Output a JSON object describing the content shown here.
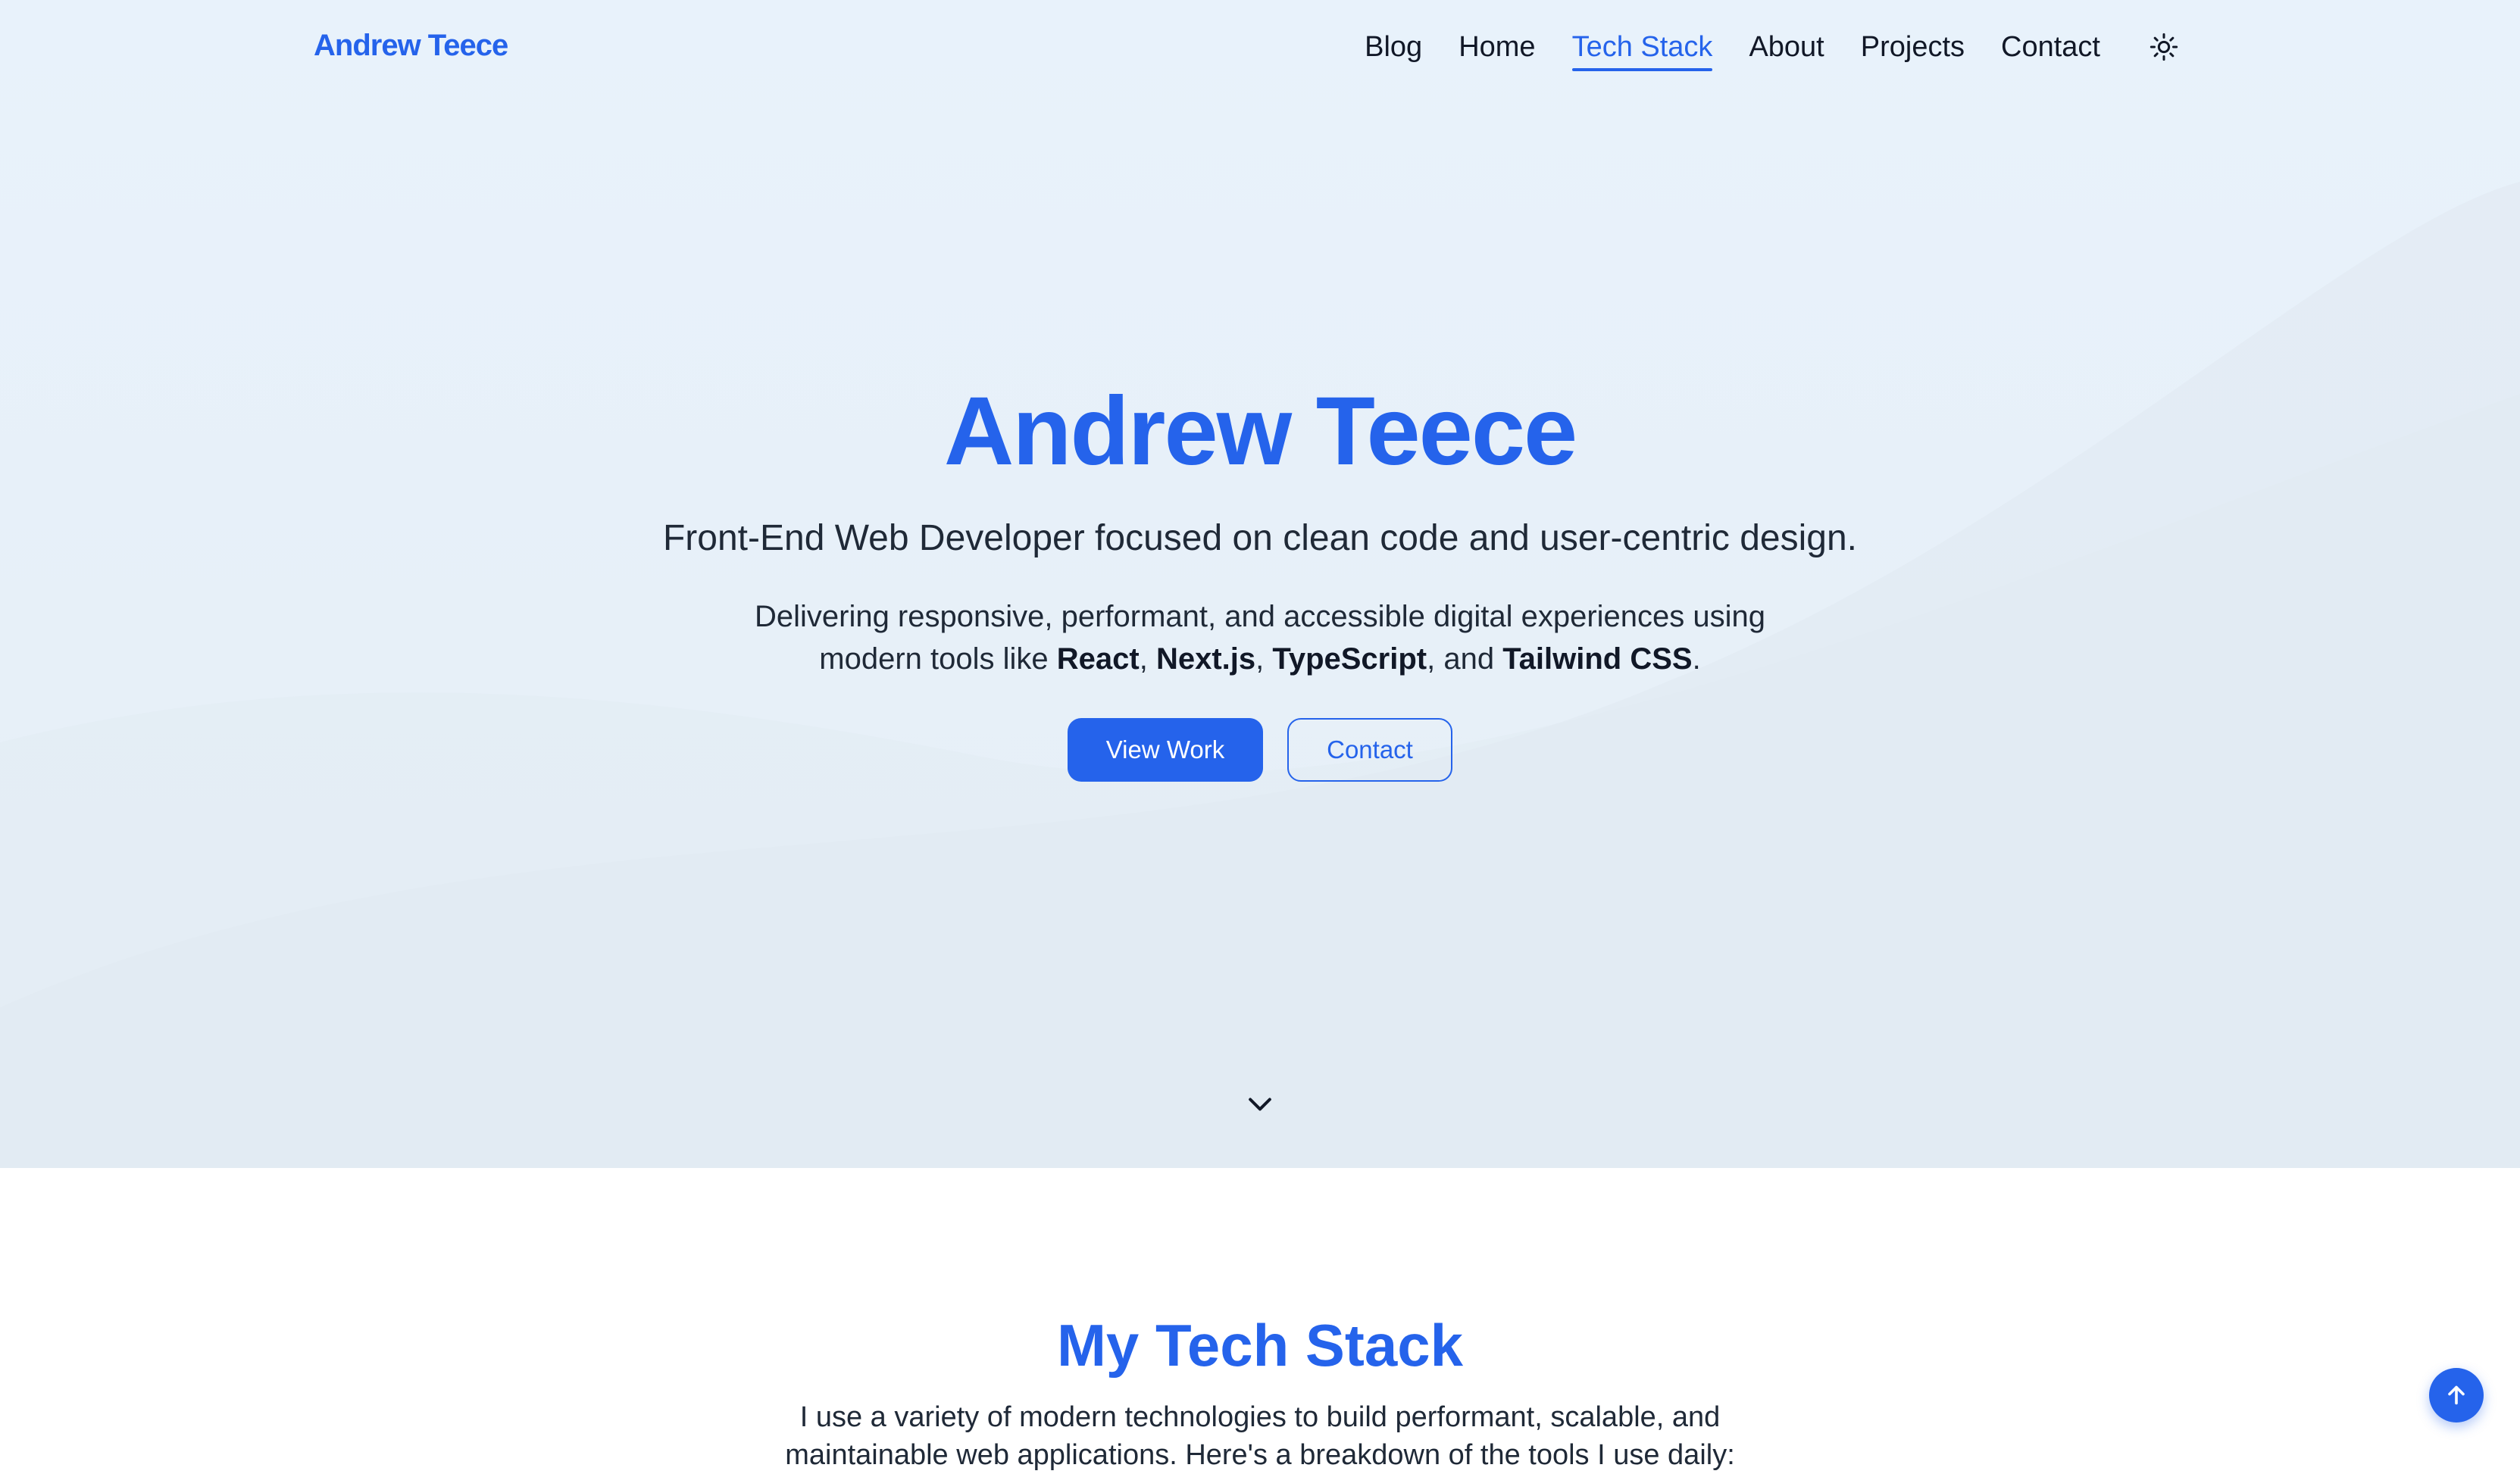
{
  "header": {
    "logo": "Andrew Teece",
    "nav": [
      {
        "label": "Blog",
        "active": false
      },
      {
        "label": "Home",
        "active": false
      },
      {
        "label": "Tech Stack",
        "active": true
      },
      {
        "label": "About",
        "active": false
      },
      {
        "label": "Projects",
        "active": false
      },
      {
        "label": "Contact",
        "active": false
      }
    ],
    "theme_icon": "sun-icon"
  },
  "hero": {
    "title": "Andrew Teece",
    "subtitle": "Front-End Web Developer focused on clean code and user-centric design.",
    "desc_part1": "Delivering responsive, performant, and accessible digital experiences using modern tools like ",
    "tech": [
      "React",
      "Next.js",
      "TypeScript",
      "Tailwind CSS"
    ],
    "sep1": ", ",
    "sep2": ", ",
    "sep3": ", and ",
    "desc_end": ".",
    "primary_button": "View Work",
    "secondary_button": "Contact",
    "scroll_icon": "chevron-down-icon"
  },
  "tech_section": {
    "title": "My Tech Stack",
    "description": "I use a variety of modern technologies to build performant, scalable, and maintainable web applications. Here's a breakdown of the tools I use daily:"
  },
  "back_to_top_icon": "arrow-up-icon",
  "colors": {
    "accent": "#2563eb",
    "hero_bg": "#e8f2fb",
    "text": "#111827"
  }
}
